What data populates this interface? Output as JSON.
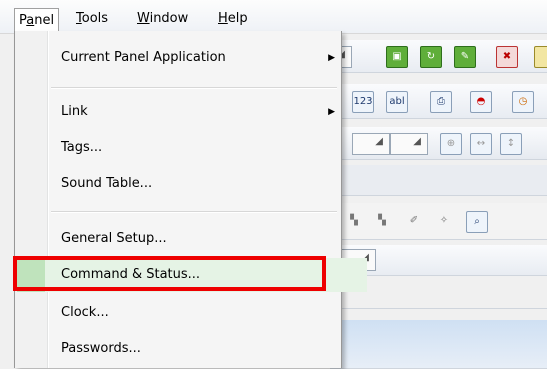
{
  "menubar": {
    "items": [
      {
        "label": "Panel",
        "underline": "a"
      },
      {
        "label": "Tools",
        "underline": "T"
      },
      {
        "label": "Window",
        "underline": "W"
      },
      {
        "label": "Help",
        "underline": "H"
      }
    ]
  },
  "panel_menu": {
    "items": [
      {
        "label": "Current Panel Application",
        "has_submenu": true
      },
      {
        "label": "Link",
        "has_submenu": true
      },
      {
        "label": "Tags..."
      },
      {
        "label": "Sound Table..."
      },
      {
        "label": "General Setup..."
      },
      {
        "label": "Command & Status...",
        "highlighted": true
      },
      {
        "label": "Clock..."
      },
      {
        "label": "Passwords..."
      }
    ],
    "submenu_arrow": "▶",
    "highlight_color": "#e5f3e5",
    "callout_color": "#ee0000"
  },
  "toolbar_icons": {
    "abc": "abl",
    "num": "123"
  }
}
